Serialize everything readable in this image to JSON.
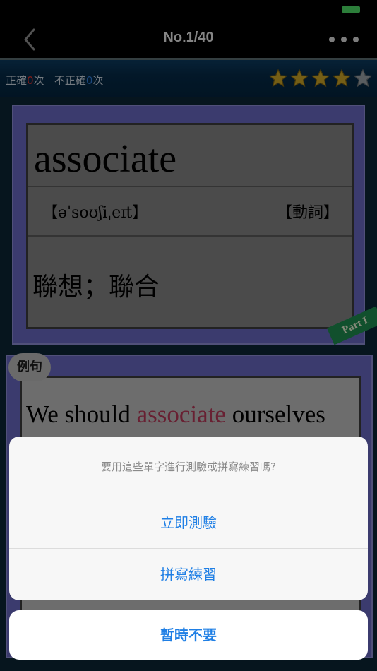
{
  "nav": {
    "title": "No.1/40"
  },
  "score": {
    "correct_label": "正確",
    "correct_count": "0",
    "correct_unit": "次",
    "incorrect_label": "不正確",
    "incorrect_count": "0",
    "incorrect_unit": "次"
  },
  "rating": {
    "filled": 4,
    "total": 5
  },
  "card": {
    "word": "associate",
    "phonetic": "【əˈsoʊʃiˌeɪt】",
    "part_of_speech": "【動詞】",
    "meaning": "聯想；聯合",
    "badge": "Part I"
  },
  "example": {
    "tag": "例句",
    "before": "We should ",
    "highlight": "associate",
    "after": " ourselves"
  },
  "sheet": {
    "message": "要用這些單字進行測驗或拼寫練習嗎?",
    "option_quiz": "立即測驗",
    "option_spelling": "拼寫練習",
    "cancel": "暫時不要"
  },
  "colors": {
    "accent": "#1f7fe5",
    "card": "#6767be",
    "highlight": "#b33857",
    "badge": "#1e8a4e"
  }
}
